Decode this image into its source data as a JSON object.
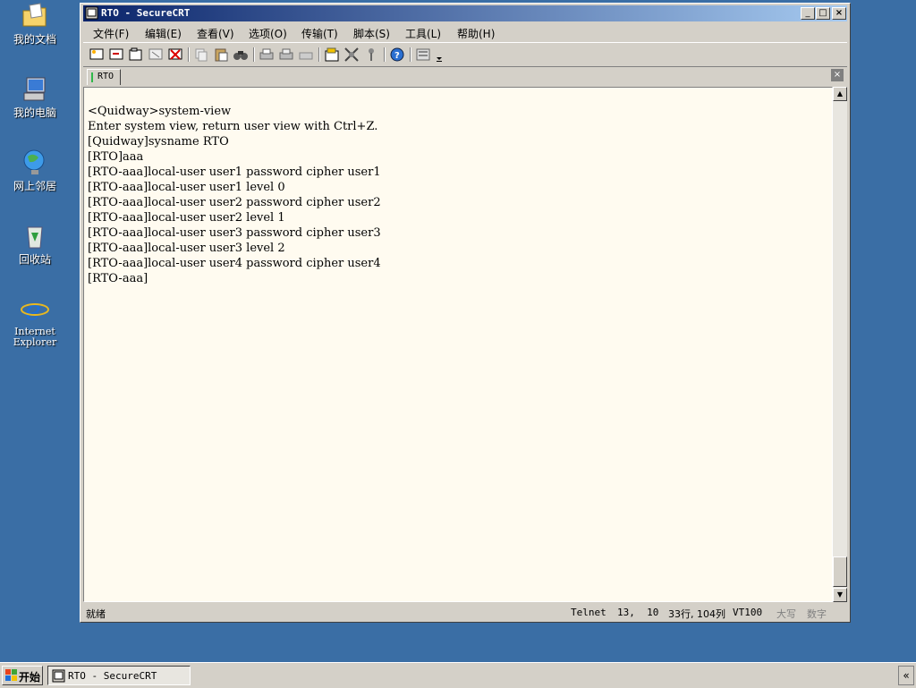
{
  "desktop": {
    "icons": [
      {
        "label": "我的文档"
      },
      {
        "label": "我的电脑"
      },
      {
        "label": "网上邻居"
      },
      {
        "label": "回收站"
      },
      {
        "label": "Internet Explorer"
      }
    ]
  },
  "window": {
    "title": "RTO - SecureCRT",
    "controls": {
      "minimize": "_",
      "maximize": "□",
      "close": "×"
    }
  },
  "menu": [
    "文件(F)",
    "编辑(E)",
    "查看(V)",
    "选项(O)",
    "传输(T)",
    "脚本(S)",
    "工具(L)",
    "帮助(H)"
  ],
  "tab": {
    "label": "RTO",
    "close": "×"
  },
  "terminal": {
    "lines": [
      "<Quidway>system-view",
      "Enter system view, return user view with Ctrl+Z.",
      "[Quidway]sysname RTO",
      "[RTO]aaa",
      "[RTO-aaa]local-user user1 password cipher user1",
      "[RTO-aaa]local-user user1 level 0",
      "[RTO-aaa]local-user user2 password cipher user2",
      "[RTO-aaa]local-user user2 level 1",
      "[RTO-aaa]local-user user3 password cipher user3",
      "[RTO-aaa]local-user user3 level 2",
      "[RTO-aaa]local-user user4 password cipher user4",
      "[RTO-aaa]"
    ]
  },
  "status": {
    "ready": "就绪",
    "protocol": "Telnet",
    "cursor": "13,  10",
    "size": "33行, 104列",
    "emulation": "VT100",
    "caps": "大写",
    "num": "数字"
  },
  "taskbar": {
    "start": "开始",
    "task": "RTO - SecureCRT",
    "tray": "«"
  }
}
